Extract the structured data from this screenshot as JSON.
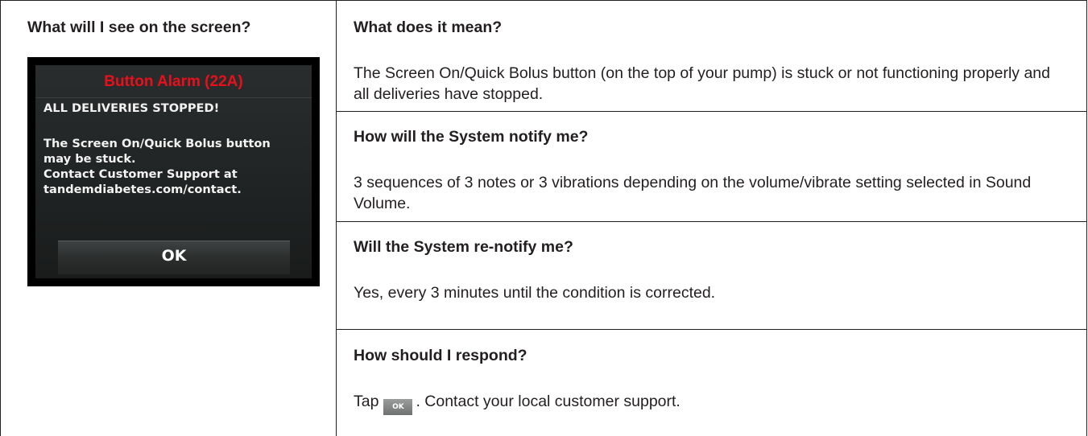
{
  "left": {
    "header": "What will I see on the screen?",
    "pump_screen": {
      "title": "Button Alarm (22A)",
      "title_color": "#e8101b",
      "lines": [
        "ALL DELIVERIES STOPPED!",
        "The Screen On/Quick Bolus button",
        "may be stuck.",
        "Contact Customer Support at",
        "tandemdiabetes.com/contact."
      ],
      "ok_label": "OK"
    }
  },
  "sections": [
    {
      "heading": "What does it mean?",
      "body_lead": "The ",
      "body_highlight": "Screen On/Quick Bolus",
      "body_rest": " button (on the top of your pump) is stuck or not functioning properly and all deliveries have stopped."
    },
    {
      "heading": "How will the System notify me?",
      "body": "3 sequences of 3 notes or 3 vibrations depending on the volume/vibrate setting selected in Sound Volume."
    },
    {
      "heading": "Will the System re-notify me?",
      "body": "Yes, every 3 minutes until the condition is corrected."
    },
    {
      "heading": "How should I respond?",
      "body_lead": "Tap",
      "ok_chip": "OK",
      "body_rest": ". Contact your local customer support."
    }
  ]
}
